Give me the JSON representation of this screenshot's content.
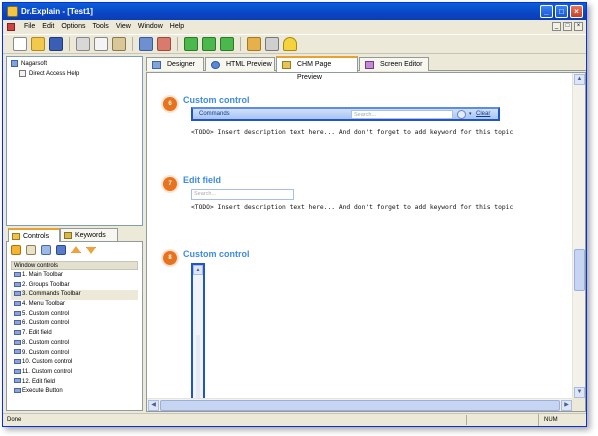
{
  "window": {
    "title": "Dr.Explain - [Test1]",
    "controls": {
      "minimize": "_",
      "maximize": "□",
      "close": "×"
    }
  },
  "menu": [
    "File",
    "Edit",
    "Options",
    "Tools",
    "View",
    "Window",
    "Help"
  ],
  "toolbar": {
    "icons": [
      "new-document-icon",
      "open-folder-icon",
      "save-icon",
      "cut-icon",
      "copy-icon",
      "paste-icon",
      "undo-icon",
      "redo-icon",
      "capture-icon",
      "capture-window-icon",
      "capture-area-icon",
      "export-icon",
      "print-icon",
      "help-icon"
    ]
  },
  "tree": {
    "root": "Nagarsoft",
    "child": "Direct Access Help"
  },
  "left_tabs": [
    "Controls",
    "Keywords"
  ],
  "controls_panel": {
    "header": "Window controls",
    "items": [
      "1. Main Toolbar",
      "2. Groups Toolbar",
      "3. Commands Toolbar",
      "4. Menu Toolbar",
      "5. Custom control",
      "6. Custom control",
      "7. Edit field",
      "8. Custom control",
      "9. Custom control",
      "10. Custom control",
      "11. Custom control",
      "12. Edit field",
      "Execute Button"
    ],
    "selected_index": 2
  },
  "right_tabs": [
    "Designer",
    "HTML Preview",
    "CHM Page Preview",
    "Screen Editor"
  ],
  "active_right_tab": "CHM Page Preview",
  "sections": [
    {
      "number": "6",
      "title": "Custom control",
      "description": "<TODO> Insert description text here... And don't forget to add keyword for this topic"
    },
    {
      "number": "7",
      "title": "Edit field",
      "description": "<TODO> Insert description text here... And don't forget to add keyword for this topic"
    },
    {
      "number": "8",
      "title": "Custom control"
    }
  ],
  "commands_bar": {
    "label": "Commands",
    "search_placeholder": "Search...",
    "dropdown": "▾",
    "clear": "Clear"
  },
  "edit_field": {
    "placeholder": "Search..."
  },
  "scroll_arrows": {
    "up": "▲",
    "down": "▼",
    "left": "◀",
    "right": "▶"
  },
  "status": {
    "left": "Done",
    "right": "NUM"
  },
  "colors": {
    "accent": "#3e8be0",
    "number_badge": "#e8731f",
    "title_bar": "#0b45c4"
  }
}
